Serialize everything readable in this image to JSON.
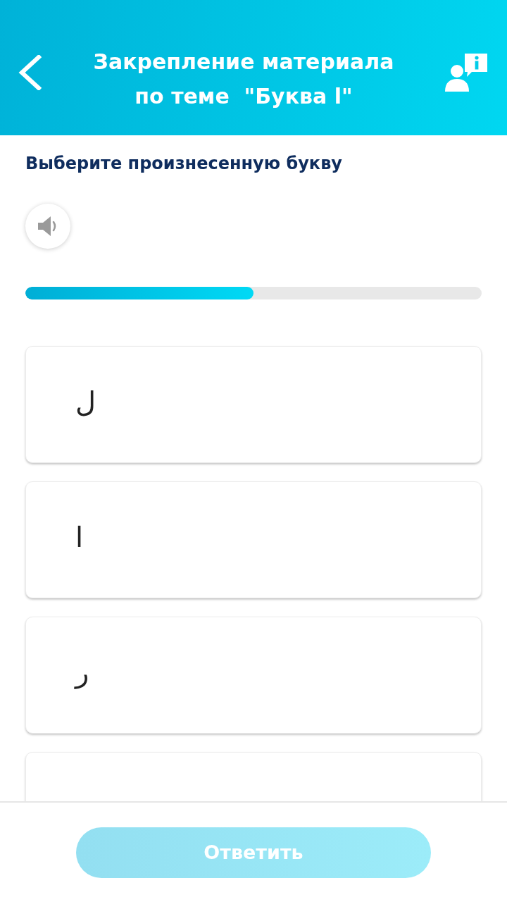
{
  "header": {
    "title": "Закрепление материала по теме  \"Буква ا\""
  },
  "question": {
    "prompt": "Выберите произнесенную букву"
  },
  "progress": {
    "level": 0.5
  },
  "options": [
    {
      "letter": "ل",
      "selected": false
    },
    {
      "letter": "ا",
      "selected": false
    },
    {
      "letter": "ر",
      "selected": false
    },
    {
      "selected": false
    }
  ],
  "answer_button": {
    "label": "Ответить",
    "disabled": true
  }
}
